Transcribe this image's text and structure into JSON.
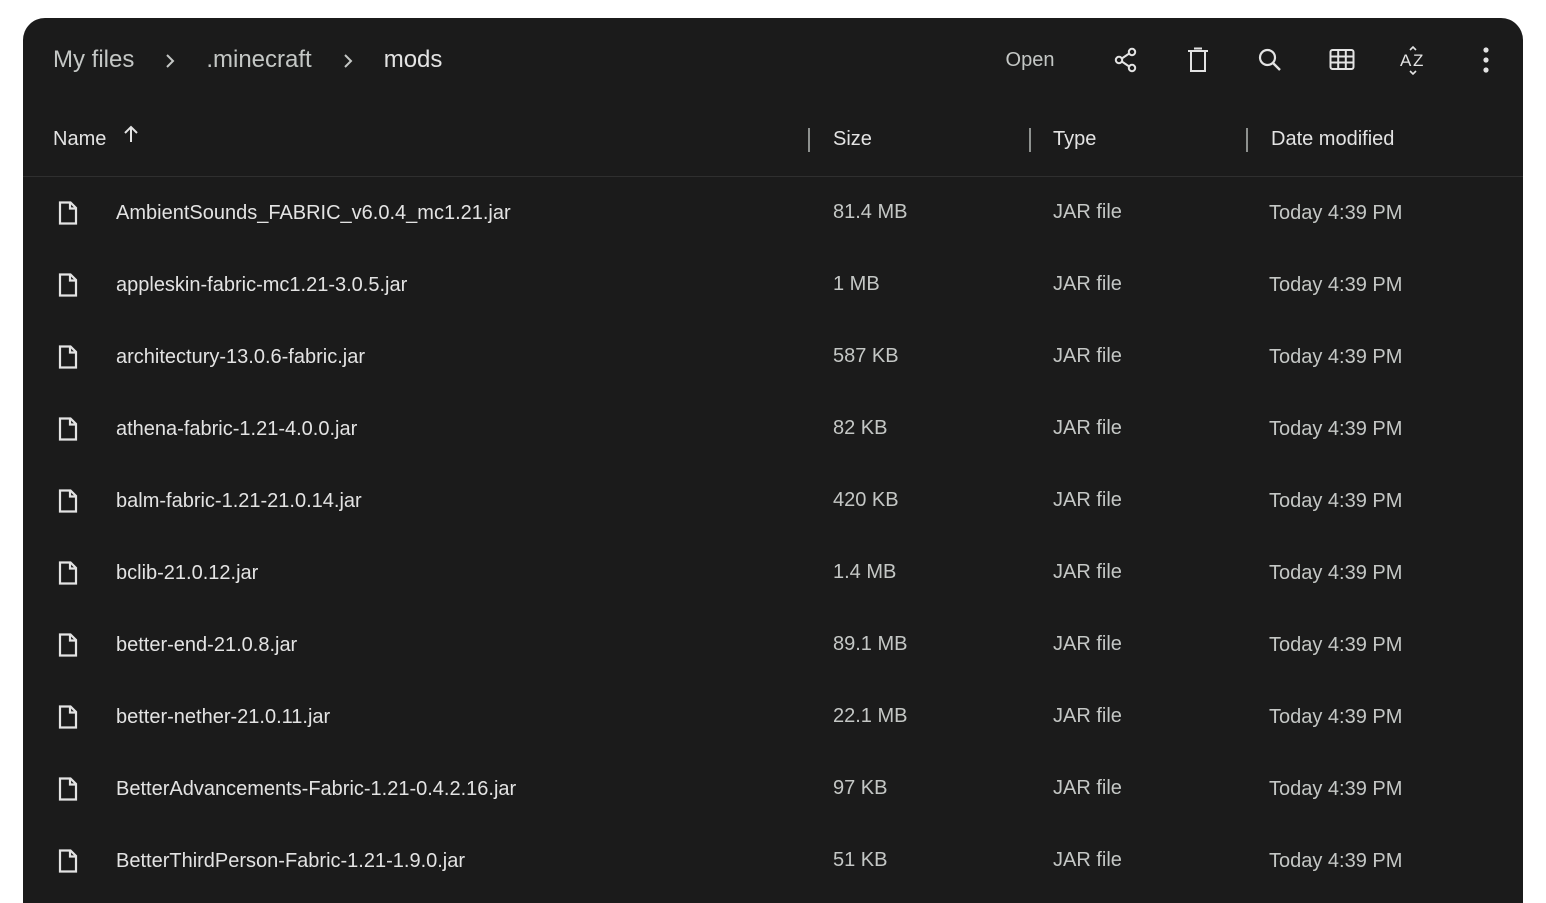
{
  "toolbar": {
    "breadcrumb": [
      "My files",
      ".minecraft",
      "mods"
    ],
    "open_label": "Open",
    "icons": [
      "share-icon",
      "delete-icon",
      "search-icon",
      "grid-view-icon",
      "sort-az-icon",
      "more-vert-icon"
    ]
  },
  "columns": {
    "name": "Name",
    "size": "Size",
    "type": "Type",
    "date": "Date modified",
    "sort": "ascending by name"
  },
  "files": [
    {
      "name": "AmbientSounds_FABRIC_v6.0.4_mc1.21.jar",
      "size": "81.4 MB",
      "type": "JAR file",
      "date": "Today 4:39 PM"
    },
    {
      "name": "appleskin-fabric-mc1.21-3.0.5.jar",
      "size": "1 MB",
      "type": "JAR file",
      "date": "Today 4:39 PM"
    },
    {
      "name": "architectury-13.0.6-fabric.jar",
      "size": "587 KB",
      "type": "JAR file",
      "date": "Today 4:39 PM"
    },
    {
      "name": "athena-fabric-1.21-4.0.0.jar",
      "size": "82 KB",
      "type": "JAR file",
      "date": "Today 4:39 PM"
    },
    {
      "name": "balm-fabric-1.21-21.0.14.jar",
      "size": "420 KB",
      "type": "JAR file",
      "date": "Today 4:39 PM"
    },
    {
      "name": "bclib-21.0.12.jar",
      "size": "1.4 MB",
      "type": "JAR file",
      "date": "Today 4:39 PM"
    },
    {
      "name": "better-end-21.0.8.jar",
      "size": "89.1 MB",
      "type": "JAR file",
      "date": "Today 4:39 PM"
    },
    {
      "name": "better-nether-21.0.11.jar",
      "size": "22.1 MB",
      "type": "JAR file",
      "date": "Today 4:39 PM"
    },
    {
      "name": "BetterAdvancements-Fabric-1.21-0.4.2.16.jar",
      "size": "97 KB",
      "type": "JAR file",
      "date": "Today 4:39 PM"
    },
    {
      "name": "BetterThirdPerson-Fabric-1.21-1.9.0.jar",
      "size": "51 KB",
      "type": "JAR file",
      "date": "Today 4:39 PM"
    }
  ],
  "colors": {
    "background": "#1b1b1b",
    "text_primary": "#e3e3e3",
    "text_secondary": "#c4c7c5"
  }
}
